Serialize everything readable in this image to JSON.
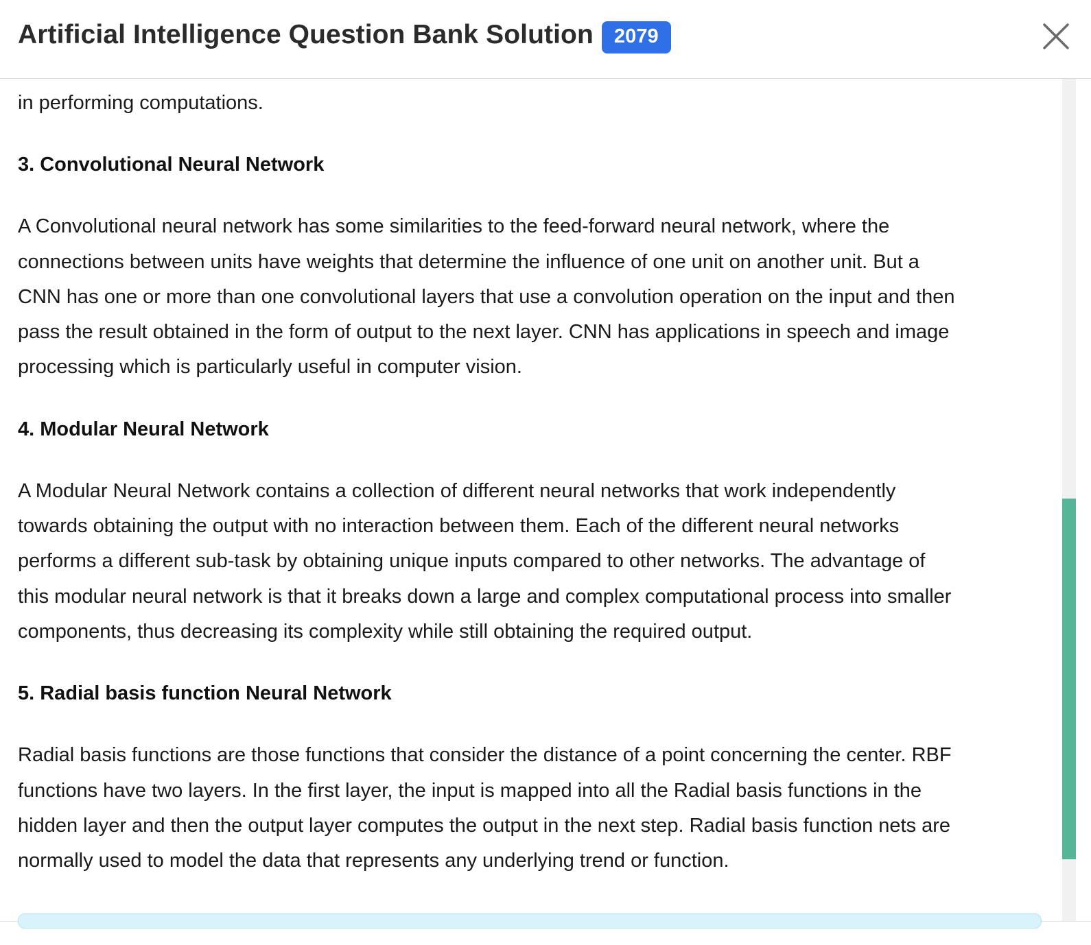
{
  "modal": {
    "title": "Artificial Intelligence Question Bank Solution",
    "year_badge": "2079",
    "close_icon": "close-icon"
  },
  "content": {
    "intro_fragment": "in performing computations.",
    "sections": [
      {
        "heading": "3. Convolutional Neural Network",
        "lines": [
          "A Convolutional neural network has some similarities to the feed-forward neural network, where the",
          "connections between units have weights that determine the influence of one unit on another unit. But a",
          "CNN has one or more than one convolutional layers that use a convolution operation on the input and then",
          "pass the result obtained in the form of output to the next layer. CNN has applications in speech and image",
          "processing which is particularly useful in computer vision."
        ]
      },
      {
        "heading": "4. Modular Neural Network",
        "lines": [
          "A Modular Neural Network contains a collection of different neural networks that work independently",
          "towards obtaining the output with no interaction between them. Each of the different neural networks",
          "performs a different sub-task by obtaining unique inputs compared to other networks. The advantage of",
          "this modular neural network is that it breaks down a large and complex computational process into smaller",
          "components, thus decreasing its complexity while still obtaining the required output."
        ]
      },
      {
        "heading": "5. Radial basis function Neural Network",
        "lines": [
          "Radial basis functions are those functions that consider the distance of a point concerning the center. RBF",
          "functions have two layers. In the first layer, the input is mapped into all the Radial basis functions in the",
          "hidden layer and then the output layer computes the output in the next step. Radial basis function nets are",
          "normally used to model the data that represents any underlying trend or function."
        ]
      }
    ]
  },
  "colors": {
    "badge": "#2f6fe8",
    "scrollbar_thumb": "#55b596",
    "next_card": "#d8f3fb"
  }
}
